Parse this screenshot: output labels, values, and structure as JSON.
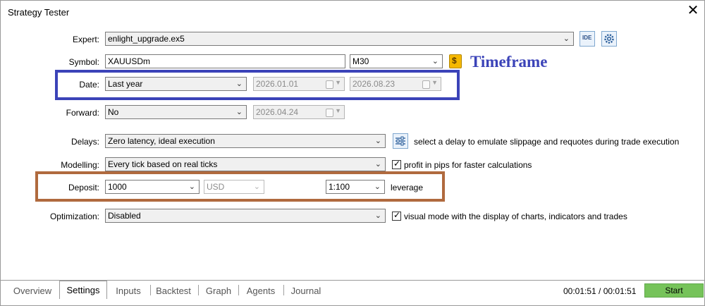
{
  "window": {
    "title": "Strategy Tester",
    "close_glyph": "✕"
  },
  "expert": {
    "label": "Expert:",
    "value": "enlight_upgrade.ex5",
    "ide_label": "IDE"
  },
  "symbol": {
    "label": "Symbol:",
    "value": "XAUUSDm",
    "timeframe": "M30"
  },
  "annotation": {
    "timeframe_text": "Timeframe",
    "date_box_color": "#3b43b8",
    "deposit_box_color": "#b06a3e",
    "timeframe_color": "#3b43b8"
  },
  "date": {
    "label": "Date:",
    "value": "Last year",
    "from": "2026.01.01",
    "to": "2026.08.23"
  },
  "forward": {
    "label": "Forward:",
    "value": "No",
    "date": "2026.04.24"
  },
  "delays": {
    "label": "Delays:",
    "value": "Zero latency, ideal execution",
    "note": "select a delay to emulate slippage and requotes during trade execution"
  },
  "modelling": {
    "label": "Modelling:",
    "value": "Every tick based on real ticks",
    "checkbox_label": "profit in pips for faster calculations",
    "checked": true
  },
  "deposit": {
    "label": "Deposit:",
    "value": "1000",
    "currency": "USD",
    "leverage_value": "1:100",
    "leverage_label": "leverage"
  },
  "optimization": {
    "label": "Optimization:",
    "value": "Disabled",
    "checkbox_label": "visual mode with the display of charts, indicators and trades",
    "checked": true
  },
  "tabs": [
    "Overview",
    "Settings",
    "Inputs",
    "Backtest",
    "Graph",
    "Agents",
    "Journal"
  ],
  "active_tab": "Settings",
  "status": {
    "time": "00:01:51 / 00:01:51",
    "start_label": "Start"
  },
  "colors": {
    "start_button": "#76c35a",
    "coin_icon": "#f5b800"
  }
}
